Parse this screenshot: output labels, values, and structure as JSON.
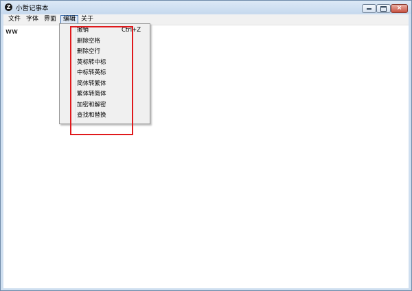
{
  "window": {
    "title": "小哲记事本",
    "app_icon_glyph": "Z",
    "buttons": {
      "minimize": "minimize",
      "maximize": "maximize",
      "close": "×"
    }
  },
  "menubar": {
    "items": [
      "文件",
      "字体",
      "界面",
      "编辑",
      "关于"
    ],
    "active_index": 3
  },
  "editor": {
    "content": "ww"
  },
  "edit_menu": {
    "items": [
      {
        "label": "撤销",
        "shortcut": "Ctrl+Z"
      },
      {
        "label": "删除空格",
        "shortcut": ""
      },
      {
        "label": "删除空行",
        "shortcut": ""
      },
      {
        "label": "英标转中标",
        "shortcut": ""
      },
      {
        "label": "中标转英标",
        "shortcut": ""
      },
      {
        "label": "简体转繁体",
        "shortcut": ""
      },
      {
        "label": "繁体转简体",
        "shortcut": ""
      },
      {
        "label": "加密和解密",
        "shortcut": ""
      },
      {
        "label": "查找和替换",
        "shortcut": ""
      }
    ]
  },
  "colors": {
    "highlight_box": "#e0191c",
    "menu_active_border": "#3c6fb0",
    "menu_background": "#f0f0f0"
  }
}
